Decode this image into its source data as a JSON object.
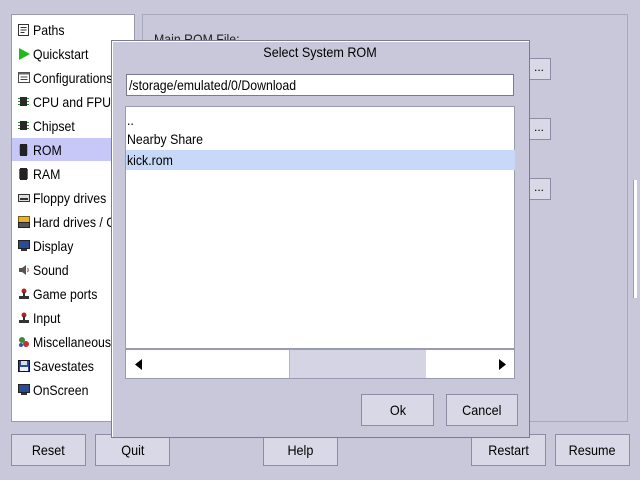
{
  "nav": {
    "items": [
      {
        "label": "Paths",
        "icon": "document-icon",
        "selected": false
      },
      {
        "label": "Quickstart",
        "icon": "play-icon",
        "selected": false
      },
      {
        "label": "Configurations",
        "icon": "config-list-icon",
        "selected": false
      },
      {
        "label": "CPU and FPU",
        "icon": "chip-icon",
        "selected": false
      },
      {
        "label": "Chipset",
        "icon": "chip-icon",
        "selected": false
      },
      {
        "label": "ROM",
        "icon": "rom-chip-icon",
        "selected": true
      },
      {
        "label": "RAM",
        "icon": "ram-chip-icon",
        "selected": false
      },
      {
        "label": "Floppy drives",
        "icon": "floppy-drive-icon",
        "selected": false
      },
      {
        "label": "Hard drives / CD",
        "icon": "hard-drive-icon",
        "selected": false
      },
      {
        "label": "Display",
        "icon": "monitor-icon",
        "selected": false
      },
      {
        "label": "Sound",
        "icon": "sound-icon",
        "selected": false
      },
      {
        "label": "Game ports",
        "icon": "joystick-icon",
        "selected": false
      },
      {
        "label": "Input",
        "icon": "joystick-icon",
        "selected": false
      },
      {
        "label": "Miscellaneous",
        "icon": "misc-icon",
        "selected": false
      },
      {
        "label": "Savestates",
        "icon": "save-icon",
        "selected": false
      },
      {
        "label": "OnScreen",
        "icon": "monitor-icon",
        "selected": false
      }
    ]
  },
  "main": {
    "section_label": "Main ROM File:",
    "browse_label": "..."
  },
  "buttons": {
    "reset": "Reset",
    "quit": "Quit",
    "help": "Help",
    "restart": "Restart",
    "resume": "Resume"
  },
  "dialog": {
    "title": "Select System ROM",
    "path": "/storage/emulated/0/Download",
    "files": [
      {
        "name": "..",
        "selected": false
      },
      {
        "name": "Nearby Share",
        "selected": false
      },
      {
        "name": "kick.rom",
        "selected": true
      }
    ],
    "ok": "Ok",
    "cancel": "Cancel",
    "hscroll_position": 0.68
  },
  "colors": {
    "background": "#c8c8da",
    "selection_nav": "#c8c8f8",
    "selection_file": "#c8d8f8",
    "play_icon": "#1fb81f"
  }
}
